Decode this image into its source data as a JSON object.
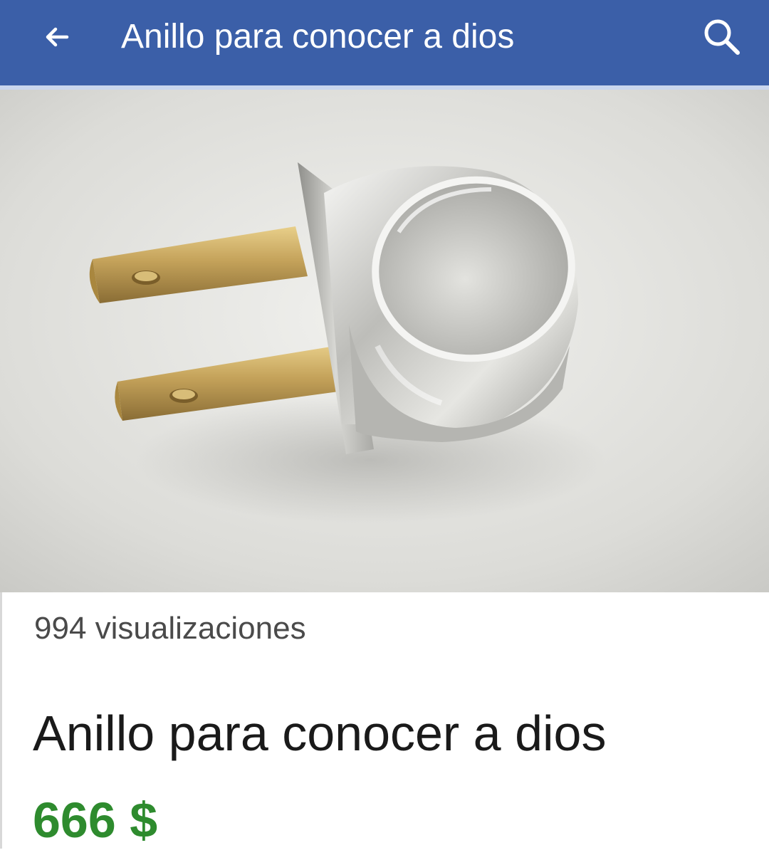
{
  "header": {
    "back_icon": "arrow-left-icon",
    "title": "Anillo para conocer a dios",
    "search_icon": "search-icon",
    "background_color": "#3b5fa8"
  },
  "listing": {
    "views": "994 visualizaciones",
    "title": "Anillo para conocer a dios",
    "price": "666 $",
    "price_color": "#2e8b2e"
  }
}
